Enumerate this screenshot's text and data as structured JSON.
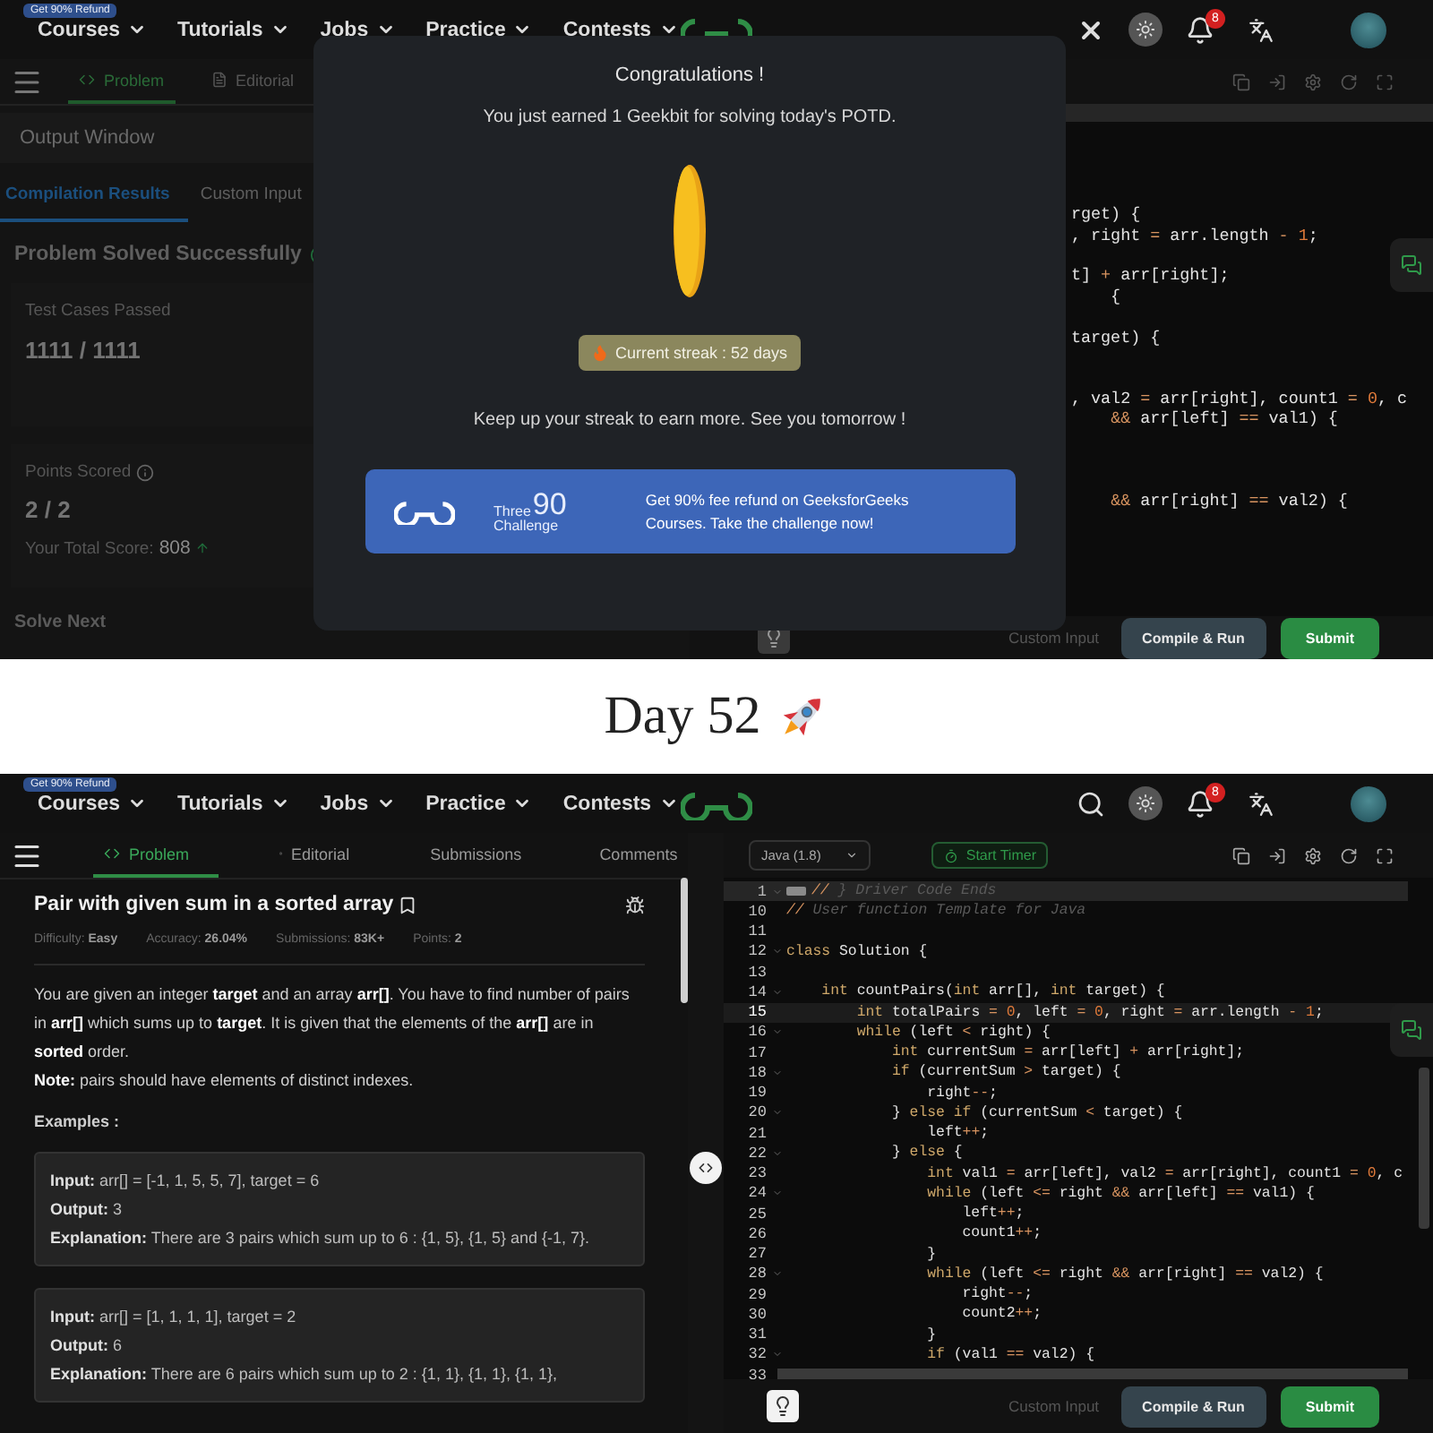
{
  "top_screen": {
    "nav": {
      "refund_badge": "Get 90% Refund",
      "items": [
        "Courses",
        "Tutorials",
        "Jobs",
        "Practice",
        "Contests"
      ],
      "notification_count": "8"
    },
    "problem_tabs": [
      {
        "label": "Problem",
        "selected": true
      },
      {
        "label": "Editorial",
        "selected": false
      }
    ],
    "output_window": {
      "title": "Output Window",
      "tabs": [
        {
          "label": "Compilation Results",
          "selected": true
        },
        {
          "label": "Custom Input",
          "selected": false
        }
      ],
      "status": "Problem Solved Successfully",
      "test_cases": {
        "label": "Test Cases Passed",
        "value": "1111 / 1111"
      },
      "points": {
        "label": "Points Scored",
        "value": "2 / 2",
        "total_label": "Your Total Score:",
        "total": "808"
      },
      "solve_next": "Solve Next"
    },
    "code_fragments": [
      {
        "covered": false,
        "text": "rget) {"
      },
      {
        "covered": false,
        "text": ", right = arr.length - 1;"
      },
      {
        "covered": true
      },
      {
        "covered": false,
        "text": "t] + arr[right];"
      },
      {
        "covered": false,
        "text": "    {"
      },
      {
        "covered": true
      },
      {
        "covered": false,
        "text": "target) {"
      },
      {
        "covered": true
      },
      {
        "covered": true
      },
      {
        "covered": false,
        "text": ", val2 = arr[right], count1 = 0, c"
      },
      {
        "covered": false,
        "text": "    && arr[left] == val1) {"
      },
      {
        "covered": true
      },
      {
        "covered": true
      },
      {
        "covered": true
      },
      {
        "covered": false,
        "text": "    && arr[right] == val2) {"
      }
    ],
    "editor_footer": {
      "custom_input": "Custom Input",
      "compile": "Compile & Run",
      "submit": "Submit"
    },
    "modal": {
      "title": "Congratulations !",
      "message": "You just earned 1 Geekbit for solving today's POTD.",
      "streak": "Current streak : 52 days",
      "footer": "Keep up your streak to earn more. See you tomorrow !",
      "promo": {
        "brand_word": "Three",
        "brand_number": "90",
        "brand_tag": "Challenge",
        "text": "Get 90% fee refund on GeeksforGeeks Courses. Take the challenge now!"
      }
    }
  },
  "caption": "Day 52",
  "bottom_screen": {
    "nav": {
      "refund_badge": "Get 90% Refund",
      "items": [
        "Courses",
        "Tutorials",
        "Jobs",
        "Practice",
        "Contests"
      ],
      "notification_count": "8"
    },
    "problem_tabs": [
      {
        "label": "Problem",
        "selected": true
      },
      {
        "label": "Editorial",
        "selected": false
      },
      {
        "label": "Submissions",
        "selected": false
      },
      {
        "label": "Comments",
        "selected": false
      }
    ],
    "problem": {
      "title": "Pair with given sum in a sorted array",
      "meta": [
        {
          "label": "Difficulty:",
          "value": "Easy"
        },
        {
          "label": "Accuracy:",
          "value": "26.04%"
        },
        {
          "label": "Submissions:",
          "value": "83K+"
        },
        {
          "label": "Points:",
          "value": "2"
        }
      ],
      "description": "You are given an integer **target** and an array **arr[]**. You have to find number of pairs in **arr[]** which sums up to **target**. It is given that the elements of the **arr[]** are in **sorted** order.",
      "note": "**Note:** pairs should have elements of distinct indexes.",
      "examples_heading": "Examples :",
      "examples": [
        [
          {
            "label": "Input:",
            "value": "arr[] = [-1, 1, 5, 5, 7], target = 6"
          },
          {
            "label": "Output:",
            "value": "3"
          },
          {
            "label": "Explanation:",
            "value": "There are 3 pairs which sum up to 6 : {1, 5}, {1, 5} and {-1, 7}."
          }
        ],
        [
          {
            "label": "Input:",
            "value": "arr[] = [1, 1, 1, 1], target = 2"
          },
          {
            "label": "Output:",
            "value": "6"
          },
          {
            "label": "Explanation:",
            "value": "There are 6 pairs which sum up to 2 : {1, 1}, {1, 1}, {1, 1},"
          }
        ]
      ]
    },
    "editor": {
      "language": "Java (1.8)",
      "timer": "Start Timer",
      "lines": [
        {
          "number": "1",
          "kind": "comment",
          "foldable": true,
          "folded": true,
          "current": false,
          "text": "// } Driver Code Ends"
        },
        {
          "number": "10",
          "kind": "comment",
          "foldable": false,
          "folded": false,
          "current": false,
          "text": "// User function Template for Java"
        },
        {
          "number": "11",
          "kind": "code",
          "foldable": false,
          "folded": false,
          "current": false
        },
        {
          "number": "12",
          "kind": "code",
          "foldable": true,
          "folded": false,
          "current": false,
          "text": "class Solution {"
        },
        {
          "number": "13",
          "kind": "code",
          "foldable": false,
          "folded": false,
          "current": false
        },
        {
          "number": "14",
          "kind": "code",
          "foldable": true,
          "folded": false,
          "current": false,
          "text": "    int countPairs(int arr[], int target) {"
        },
        {
          "number": "15",
          "kind": "code",
          "foldable": false,
          "folded": false,
          "current": true,
          "text": "        int totalPairs = 0, left = 0, right = arr.length - 1;"
        },
        {
          "number": "16",
          "kind": "code",
          "foldable": true,
          "folded": false,
          "current": false,
          "text": "        while (left < right) {"
        },
        {
          "number": "17",
          "kind": "code",
          "foldable": false,
          "folded": false,
          "current": false,
          "text": "            int currentSum = arr[left] + arr[right];"
        },
        {
          "number": "18",
          "kind": "code",
          "foldable": true,
          "folded": false,
          "current": false,
          "text": "            if (currentSum > target) {"
        },
        {
          "number": "19",
          "kind": "code",
          "foldable": false,
          "folded": false,
          "current": false,
          "text": "                right--;"
        },
        {
          "number": "20",
          "kind": "code",
          "foldable": true,
          "folded": false,
          "current": false,
          "text": "            } else if (currentSum < target) {"
        },
        {
          "number": "21",
          "kind": "code",
          "foldable": false,
          "folded": false,
          "current": false,
          "text": "                left++;"
        },
        {
          "number": "22",
          "kind": "code",
          "foldable": true,
          "folded": false,
          "current": false,
          "text": "            } else {"
        },
        {
          "number": "23",
          "kind": "code",
          "foldable": false,
          "folded": false,
          "current": false,
          "text": "                int val1 = arr[left], val2 = arr[right], count1 = 0, c"
        },
        {
          "number": "24",
          "kind": "code",
          "foldable": true,
          "folded": false,
          "current": false,
          "text": "                while (left <= right && arr[left] == val1) {"
        },
        {
          "number": "25",
          "kind": "code",
          "foldable": false,
          "folded": false,
          "current": false,
          "text": "                    left++;"
        },
        {
          "number": "26",
          "kind": "code",
          "foldable": false,
          "folded": false,
          "current": false,
          "text": "                    count1++;"
        },
        {
          "number": "27",
          "kind": "code",
          "foldable": false,
          "folded": false,
          "current": false,
          "text": "                }"
        },
        {
          "number": "28",
          "kind": "code",
          "foldable": true,
          "folded": false,
          "current": false,
          "text": "                while (left <= right && arr[right] == val2) {"
        },
        {
          "number": "29",
          "kind": "code",
          "foldable": false,
          "folded": false,
          "current": false,
          "text": "                    right--;"
        },
        {
          "number": "30",
          "kind": "code",
          "foldable": false,
          "folded": false,
          "current": false,
          "text": "                    count2++;"
        },
        {
          "number": "31",
          "kind": "code",
          "foldable": false,
          "folded": false,
          "current": false,
          "text": "                }"
        },
        {
          "number": "32",
          "kind": "code",
          "foldable": true,
          "folded": false,
          "current": false,
          "text": "                if (val1 == val2) {"
        },
        {
          "number": "33",
          "kind": "code",
          "foldable": false,
          "folded": false,
          "current": false
        }
      ]
    },
    "editor_footer": {
      "custom_input": "Custom Input",
      "compile": "Compile & Run",
      "submit": "Submit"
    }
  }
}
